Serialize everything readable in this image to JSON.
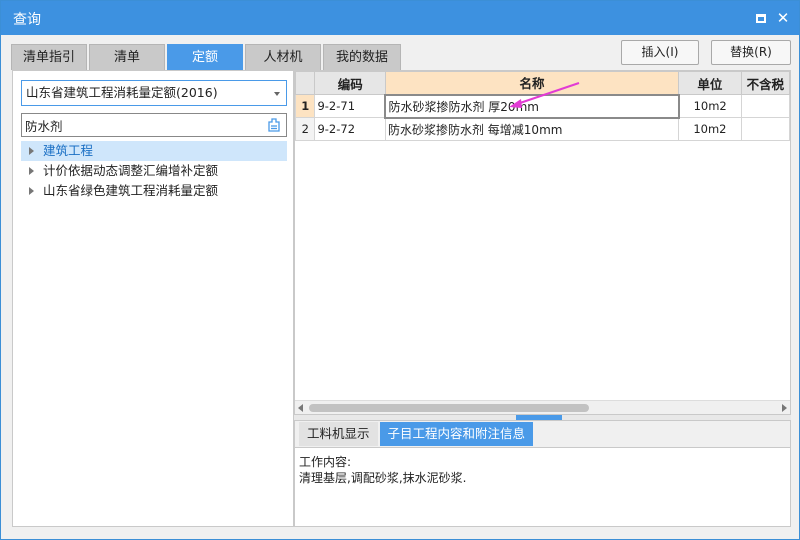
{
  "window": {
    "title": "查询"
  },
  "tabs": [
    "清单指引",
    "清单",
    "定额",
    "人材机",
    "我的数据"
  ],
  "buttons": {
    "insert": "插入(I)",
    "replace": "替换(R)"
  },
  "quota_select": {
    "value": "山东省建筑工程消耗量定额(2016)"
  },
  "search": {
    "value": "防水剂"
  },
  "tree": [
    "建筑工程",
    "计价依据动态调整汇编增补定额",
    "山东省绿色建筑工程消耗量定额"
  ],
  "grid": {
    "columns": {
      "code": "编码",
      "name": "名称",
      "unit": "单位",
      "extra": "不含税"
    },
    "rows": [
      {
        "num": "1",
        "code": "9-2-71",
        "name": "防水砂浆掺防水剂 厚20mm",
        "unit": "10m2",
        "extra": ""
      },
      {
        "num": "2",
        "code": "9-2-72",
        "name": "防水砂浆掺防水剂 每增减10mm",
        "unit": "10m2",
        "extra": ""
      }
    ]
  },
  "detail_tabs": [
    "工料机显示",
    "子目工程内容和附注信息"
  ],
  "detail": {
    "heading": "工作内容:",
    "content": "清理基层,调配砂浆,抹水泥砂浆."
  },
  "colors": {
    "accent": "#3d91e0",
    "tab_active": "#4a9ae8",
    "header_highlight": "#fde3c2",
    "tree_selected": "#cfe6fb",
    "annotation_arrow": "#e23bd4"
  }
}
